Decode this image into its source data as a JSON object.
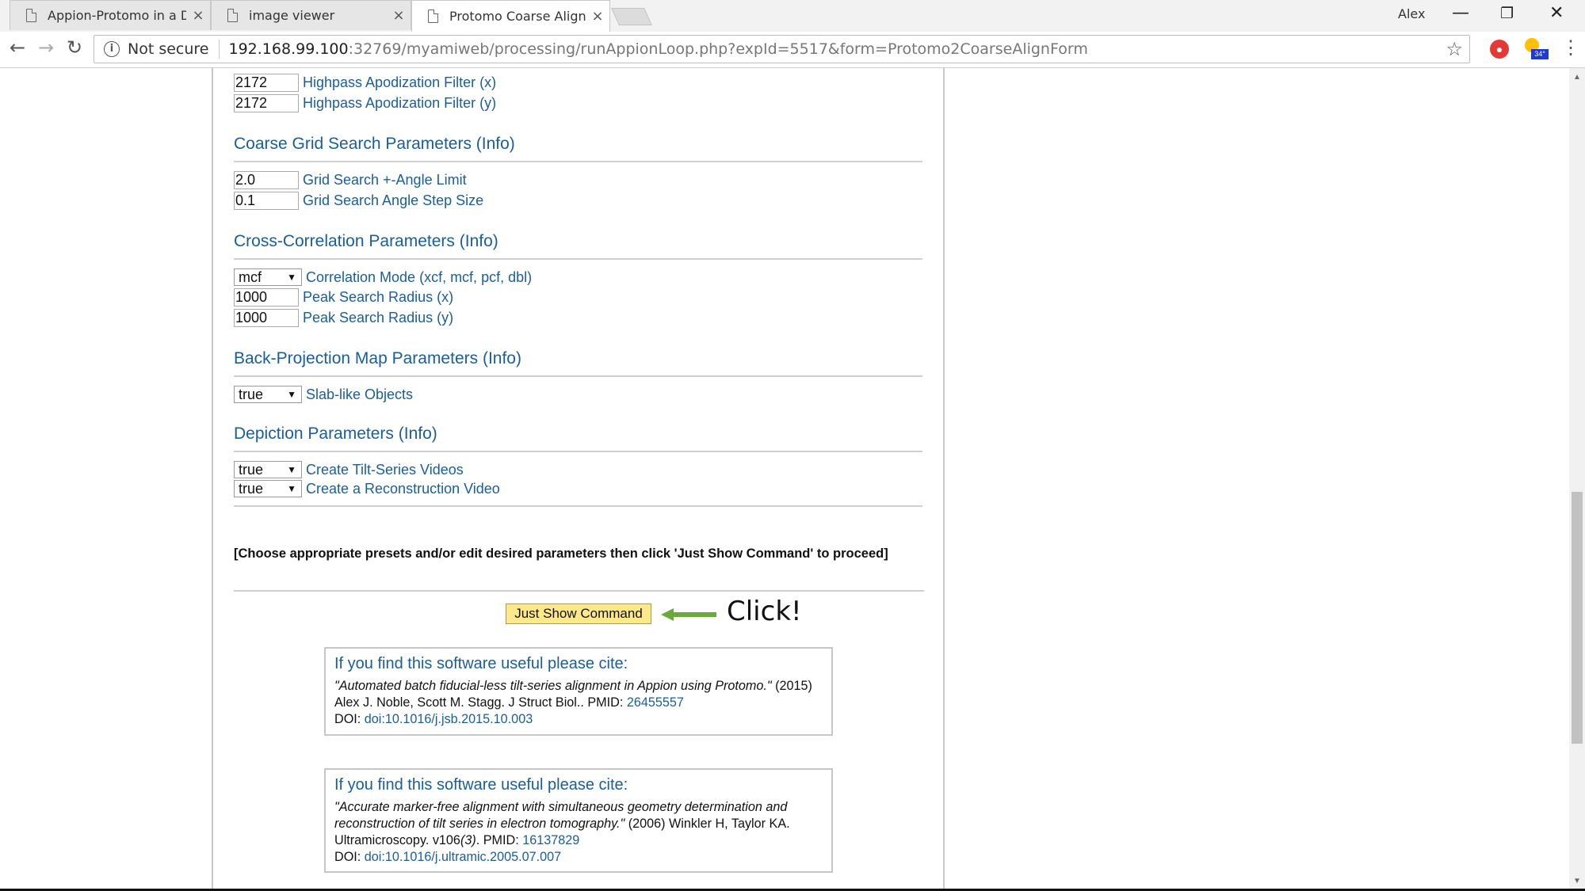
{
  "tabs": [
    {
      "title": "Appion-Protomo in a Do",
      "close": "×"
    },
    {
      "title": "image viewer",
      "close": "×"
    },
    {
      "title": "Protomo Coarse Alignme",
      "close": "×"
    }
  ],
  "profile": "Alex",
  "window": {
    "minimize": "—",
    "restore": "❐",
    "close": "✕"
  },
  "toolbar": {
    "back": "←",
    "forward": "→",
    "reload": "↻",
    "security": "Not secure",
    "url_host": "192.168.99.100",
    "url_path": ":32769/myamiweb/processing/runAppionLoop.php?expId=5517&form=Protomo2CoarseAlignForm",
    "star": "☆",
    "menu": "⋮",
    "weather_badge": "34°"
  },
  "form": {
    "highpass": [
      {
        "value": "2172",
        "label": "Highpass Apodization Filter (x)"
      },
      {
        "value": "2172",
        "label": "Highpass Apodization Filter (y)"
      }
    ],
    "coarse_title": "Coarse Grid Search Parameters (Info)",
    "coarse": [
      {
        "value": "2.0",
        "label": "Grid Search +-Angle Limit"
      },
      {
        "value": "0.1",
        "label": "Grid Search Angle Step Size"
      }
    ],
    "xcorr_title": "Cross-Correlation Parameters (Info)",
    "xcorr_mode": {
      "value": "mcf",
      "label": "Correlation Mode (xcf, mcf, pcf, dbl)"
    },
    "xcorr": [
      {
        "value": "1000",
        "label": "Peak Search Radius (x)"
      },
      {
        "value": "1000",
        "label": "Peak Search Radius (y)"
      }
    ],
    "backproj_title": "Back-Projection Map Parameters (Info)",
    "slab": {
      "value": "true",
      "label": "Slab-like Objects"
    },
    "depict_title": "Depiction Parameters (Info)",
    "depict": [
      {
        "value": "true",
        "label": "Create Tilt-Series Videos"
      },
      {
        "value": "true",
        "label": "Create a Reconstruction Video"
      }
    ],
    "select_arrow": "▼",
    "instruction": "[Choose appropriate presets and/or edit desired parameters then click 'Just Show Command' to proceed]",
    "button": "Just Show Command",
    "annotation": "Click!"
  },
  "citations": [
    {
      "heading": "If you find this software useful please cite:",
      "title_italic": "\"Automated batch fiducial-less tilt-series alignment in Appion using Protomo.\"",
      "rest": " (2015) Alex J. Noble, Scott M. Stagg. J Struct Biol..  PMID: ",
      "pmid": "26455557",
      "doi_label": "DOI: ",
      "doi": "doi:10.1016/j.jsb.2015.10.003"
    },
    {
      "heading": "If you find this software useful please cite:",
      "title_italic": "\"Accurate marker-free alignment with simultaneous geometry determination and reconstruction of tilt series in electron tomography.\"",
      "rest": " (2006) Winkler H, Taylor KA. Ultramicroscopy. v106",
      "issue_italic": "(3)",
      "rest2": ".  PMID: ",
      "pmid": "16137829",
      "doi_label": "DOI: ",
      "doi": "doi:10.1016/j.ultramic.2005.07.007"
    }
  ],
  "colors": {
    "link": "#1a5e99",
    "button_bg": "#fde88a",
    "arrow": "#6aaa3a"
  }
}
